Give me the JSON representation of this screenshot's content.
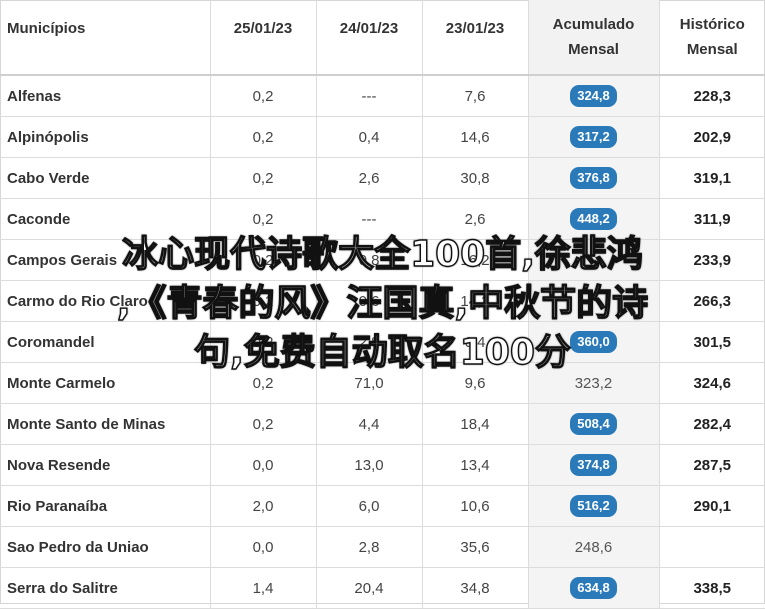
{
  "table": {
    "headers": {
      "municipio": "Municípios",
      "d1": "25/01/23",
      "d2": "24/01/23",
      "d3": "23/01/23",
      "acumulado_l1": "Acumulado",
      "acumulado_l2": "Mensal",
      "historico_l1": "Histórico",
      "historico_l2": "Mensal"
    },
    "rows": [
      {
        "name": "Alfenas",
        "d1": "0,2",
        "d2": "---",
        "d3": "7,6",
        "acc": "324,8",
        "hist": "228,3"
      },
      {
        "name": "Alpinópolis",
        "d1": "0,2",
        "d2": "0,4",
        "d3": "14,6",
        "acc": "317,2",
        "hist": "202,9"
      },
      {
        "name": "Cabo Verde",
        "d1": "0,2",
        "d2": "2,6",
        "d3": "30,8",
        "acc": "376,8",
        "hist": "319,1"
      },
      {
        "name": "Caconde",
        "d1": "0,2",
        "d2": "---",
        "d3": "2,6",
        "acc": "448,2",
        "hist": "311,9"
      },
      {
        "name": "Campos Gerais",
        "d1": "0,2",
        "d2": "0,8",
        "d3": "16,2",
        "acc": "",
        "hist": "233,9"
      },
      {
        "name": "Carmo do Rio Claro",
        "d1": "0,2",
        "d2": "0,6",
        "d3": "14,2",
        "acc": "",
        "hist": "266,3"
      },
      {
        "name": "Coromandel",
        "d1": "0,2",
        "d2": "2,8",
        "d3": "0,4",
        "acc": "360,0",
        "hist": "301,5"
      },
      {
        "name": "Monte Carmelo",
        "d1": "0,2",
        "d2": "71,0",
        "d3": "9,6",
        "acc": "323,2",
        "hist": "324,6"
      },
      {
        "name": "Monte Santo de Minas",
        "d1": "0,2",
        "d2": "4,4",
        "d3": "18,4",
        "acc": "508,4",
        "hist": "282,4"
      },
      {
        "name": "Nova Resende",
        "d1": "0,0",
        "d2": "13,0",
        "d3": "13,4",
        "acc": "374,8",
        "hist": "287,5"
      },
      {
        "name": "Rio Paranaíba",
        "d1": "2,0",
        "d2": "6,0",
        "d3": "10,6",
        "acc": "516,2",
        "hist": "290,1"
      },
      {
        "name": "Sao Pedro da Uniao",
        "d1": "0,0",
        "d2": "2,8",
        "d3": "35,6",
        "acc": "248,6",
        "hist": ""
      },
      {
        "name": "Serra do Salitre",
        "d1": "1,4",
        "d2": "20,4",
        "d3": "34,8",
        "acc": "634,8",
        "hist": "338,5"
      }
    ]
  },
  "overlay": {
    "line1": "冰心现代诗歌大全100首,徐悲鸿",
    "line2": ",《青春的风》汪国真,中秋节的诗",
    "line3": "句,免费自动取名100分"
  },
  "colors": {
    "badge": "#2a7ab9",
    "plain_acc": "#555555"
  }
}
